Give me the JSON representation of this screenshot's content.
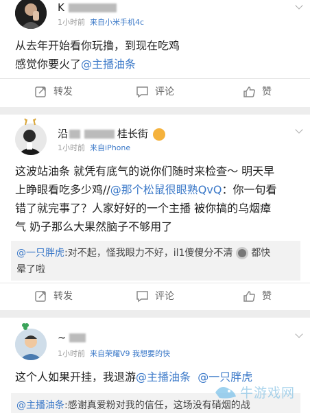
{
  "post1": {
    "username": "K",
    "meta_time": "1小时前",
    "meta_source": "来自小米手机4c",
    "text_line1": "从去年开始看你玩撸，到现在吃鸡",
    "text_line2_prefix": "感觉你要火了",
    "mention": "@主播油条",
    "actions": {
      "repost": "转发",
      "comment": "评论",
      "like": "赞"
    }
  },
  "post2": {
    "username_prefix": "沿",
    "username_suffix": "桂长街",
    "meta_time": "1小时前",
    "meta_source": "来自iPhone",
    "line1": "这波站油条 就凭有底气的说你们随时来检查～ 明天早",
    "line2_prefix": "上睁眼看吃多少鸡//",
    "line2_mention": "@那个松鼠很眼熟QvQ",
    "line2_suffix": "：你一句看",
    "line3": "错了就完事了？人家好好的一个主播 被你搞的乌烟瘴",
    "line4": "气 奶子那么大果然脑子不够用了",
    "reply_mention": "@一只胖虎",
    "reply_text": ":对不起，怪我眼力不好，il1傻傻分不清",
    "reply_text_after": "都快",
    "reply_line2": "晕了啦",
    "actions": {
      "repost": "转发",
      "comment": "评论",
      "like": "赞"
    }
  },
  "post3": {
    "username": "~",
    "meta_time": "1小时前",
    "meta_source": "来自荣耀V9 我想要的快",
    "text_prefix": "这个人如果开挂，我退游",
    "mention1": "@主播油条",
    "mention2": "@一只胖虎",
    "reply_mention": "@主播油条",
    "reply_text": ":感谢真爱粉对我的信任，这场没有硝烟的战"
  },
  "watermark": "牛游戏网",
  "colors": {
    "link": "#3a78c8",
    "divider": "#ededed",
    "reply_bg": "#f2f2f2"
  }
}
